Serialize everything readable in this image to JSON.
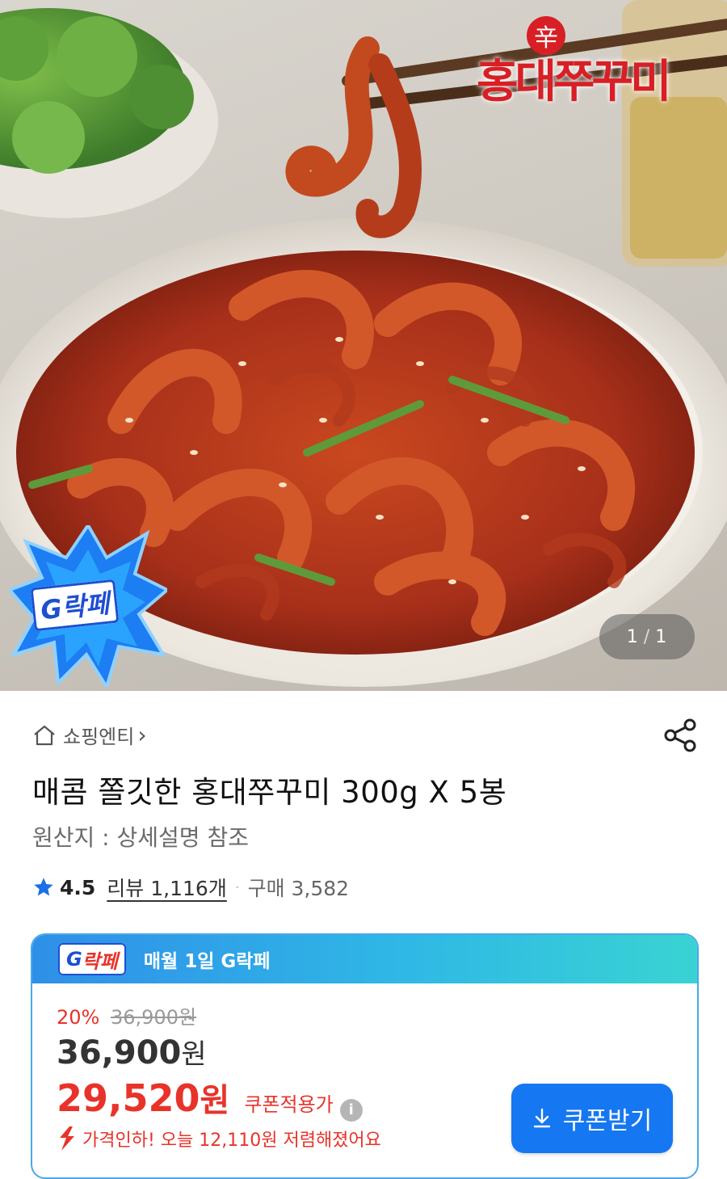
{
  "hero": {
    "brand_logo_text": "홍대쭈꾸미",
    "brand_logo_hanja": "辛",
    "promo_badge_text": "G락페",
    "counter_current": "1",
    "counter_sep": "/",
    "counter_total": "1"
  },
  "product": {
    "shop_name": "쇼핑엔티",
    "shop_chevron": "›",
    "title": "매콤 쫄깃한 홍대쭈꾸미 300g X 5봉",
    "origin": "원산지 : 상세설명 참조",
    "rating": "4.5",
    "review_label": "리뷰 1,116개",
    "dot": "·",
    "purchase_label": "구매 3,582"
  },
  "promo_card": {
    "badge_g": "G",
    "badge_rest": "락페",
    "header_text": "매월 1일 G락페",
    "discount_pct": "20%",
    "strike_price": "36,900원",
    "price_number": "36,900",
    "price_unit": "원",
    "coupon_price_number": "29,520",
    "coupon_price_unit": "원",
    "coupon_label": "쿠폰적용가",
    "info_glyph": "i",
    "price_drop_text": "가격인하! 오늘 12,110원 저렴해졌어요",
    "coupon_button_label": "쿠폰받기",
    "coupon_button_icon": "download-icon"
  },
  "colors": {
    "accent_red": "#e8332a",
    "accent_blue": "#1677f2",
    "star": "#1d6fe8"
  }
}
